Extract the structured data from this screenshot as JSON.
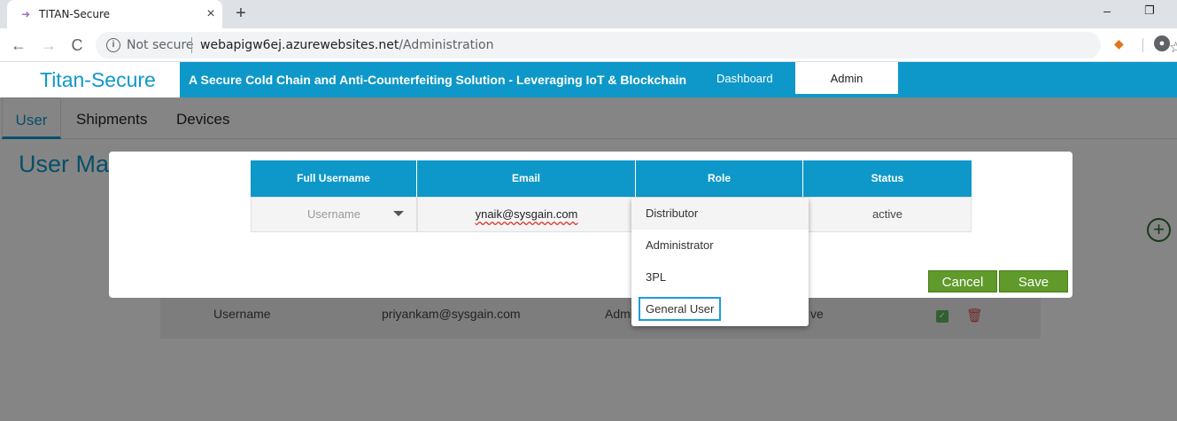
{
  "browser": {
    "tab_title": "TITAN-Secure",
    "tab_close": "×",
    "new_tab": "+",
    "minimize": "–",
    "restore": "❐",
    "back": "←",
    "forward": "→",
    "reload": "C",
    "security_label": "Not secure",
    "url_host": "webapigw6ej.azurewebsites.net",
    "url_path": "/Administration"
  },
  "header": {
    "brand": "Titan-Secure",
    "tagline": "A Secure Cold Chain and Anti-Counterfeiting Solution - Leveraging IoT & Blockchain",
    "nav": {
      "dashboard": "Dashboard",
      "admin": "Admin"
    }
  },
  "subtabs": [
    "User",
    "Shipments",
    "Devices"
  ],
  "page_title": "User Ma",
  "user_row": {
    "username": "Username",
    "email": "priyankam@sysgain.com",
    "role": "Admi",
    "status": "ve"
  },
  "modal": {
    "columns": [
      "Full Username",
      "Email",
      "Role",
      "Status"
    ],
    "username_placeholder": "Username",
    "email": "ynaik@sysgain.com",
    "status": "active",
    "cancel_label": "Cancel",
    "save_label": "Save"
  },
  "role_dropdown": {
    "options": [
      "Distributor",
      "Administrator",
      "3PL",
      "General User"
    ],
    "focused_option": "General User"
  },
  "colors": {
    "accent": "#0e98c9",
    "button_green": "#5f9a2a"
  }
}
